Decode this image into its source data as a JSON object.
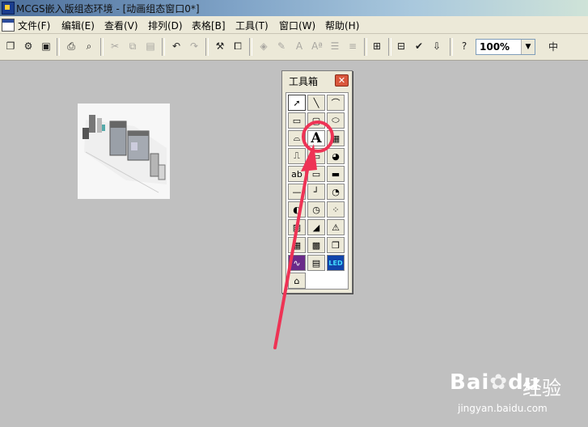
{
  "window": {
    "title": "MCGS嵌入版组态环境 - [动画组态窗口0*]"
  },
  "menu": [
    {
      "label": "文件(F)"
    },
    {
      "label": "编辑(E)"
    },
    {
      "label": "查看(V)"
    },
    {
      "label": "排列(D)"
    },
    {
      "label": "表格[B]"
    },
    {
      "label": "工具(T)"
    },
    {
      "label": "窗口(W)"
    },
    {
      "label": "帮助(H)"
    }
  ],
  "toolbar": {
    "zoom_value": "100%"
  },
  "toolbox": {
    "title": "工具箱",
    "tools": [
      {
        "name": "pointer-tool",
        "glyph": "➚"
      },
      {
        "name": "line-tool",
        "glyph": "╲"
      },
      {
        "name": "arc-tool",
        "glyph": "⌒"
      },
      {
        "name": "rectangle-tool",
        "glyph": "▭"
      },
      {
        "name": "round-rect-tool",
        "glyph": "▢"
      },
      {
        "name": "ellipse-tool",
        "glyph": "⬭"
      },
      {
        "name": "polyline-tool",
        "glyph": "⌓"
      },
      {
        "name": "label-tool",
        "glyph": "A"
      },
      {
        "name": "bitmap-tool",
        "glyph": "▦"
      },
      {
        "name": "flow-pipe-tool",
        "glyph": "⎍"
      },
      {
        "name": "button-tool",
        "glyph": "▭"
      },
      {
        "name": "pie-chart-tool",
        "glyph": "◕"
      },
      {
        "name": "input-box-tool",
        "glyph": "ab"
      },
      {
        "name": "combo-box-tool",
        "glyph": "▭"
      },
      {
        "name": "slider-tool",
        "glyph": "▬"
      },
      {
        "name": "rotate-slider-tool",
        "glyph": "—"
      },
      {
        "name": "step-tool",
        "glyph": "┘"
      },
      {
        "name": "rotation-tool",
        "glyph": "◔"
      },
      {
        "name": "animated-button-tool",
        "glyph": "◐"
      },
      {
        "name": "gauge-tool",
        "glyph": "◷"
      },
      {
        "name": "indicator-tool",
        "glyph": "⁘"
      },
      {
        "name": "trend-tool",
        "glyph": "▨"
      },
      {
        "name": "curve-tool",
        "glyph": "◢"
      },
      {
        "name": "alarm-tool",
        "glyph": "⚠"
      },
      {
        "name": "table-tool",
        "glyph": "▦"
      },
      {
        "name": "grid-table-tool",
        "glyph": "▩"
      },
      {
        "name": "sub-window-tool",
        "glyph": "❒"
      },
      {
        "name": "real-time-curve-tool",
        "glyph": "∿"
      },
      {
        "name": "report-tool",
        "glyph": "▤"
      },
      {
        "name": "led-display-tool",
        "glyph": "LED"
      },
      {
        "name": "symbol-library-tool",
        "glyph": "⌂"
      }
    ]
  },
  "watermark": {
    "brand": "Bai",
    "brand2": "du",
    "brand_jy": "经验",
    "url": "jingyan.baidu.com"
  },
  "colors": {
    "annotation": "#ee3355",
    "titlebar": "#4d6f9a",
    "canvas": "#c0c0c0"
  }
}
